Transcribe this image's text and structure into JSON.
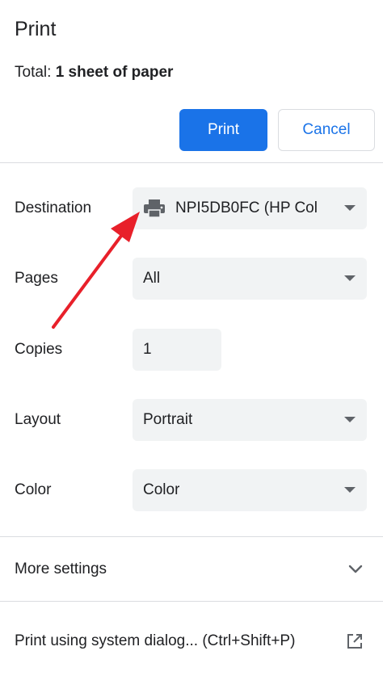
{
  "header": {
    "title": "Print",
    "total_label": "Total: ",
    "total_value": "1 sheet of paper"
  },
  "buttons": {
    "print_label": "Print",
    "cancel_label": "Cancel"
  },
  "settings": {
    "destination": {
      "label": "Destination",
      "value": "NPI5DB0FC (HP Col",
      "icon": "printer-icon"
    },
    "pages": {
      "label": "Pages",
      "value": "All"
    },
    "copies": {
      "label": "Copies",
      "value": "1"
    },
    "layout": {
      "label": "Layout",
      "value": "Portrait"
    },
    "color": {
      "label": "Color",
      "value": "Color"
    }
  },
  "more_settings": {
    "label": "More settings",
    "icon": "chevron-down-icon"
  },
  "system_dialog": {
    "label": "Print using system dialog... (Ctrl+Shift+P)",
    "icon": "external-link-icon"
  },
  "colors": {
    "accent": "#1a73e8",
    "field_bg": "#f1f3f4",
    "annotation_arrow": "#e8202a"
  }
}
